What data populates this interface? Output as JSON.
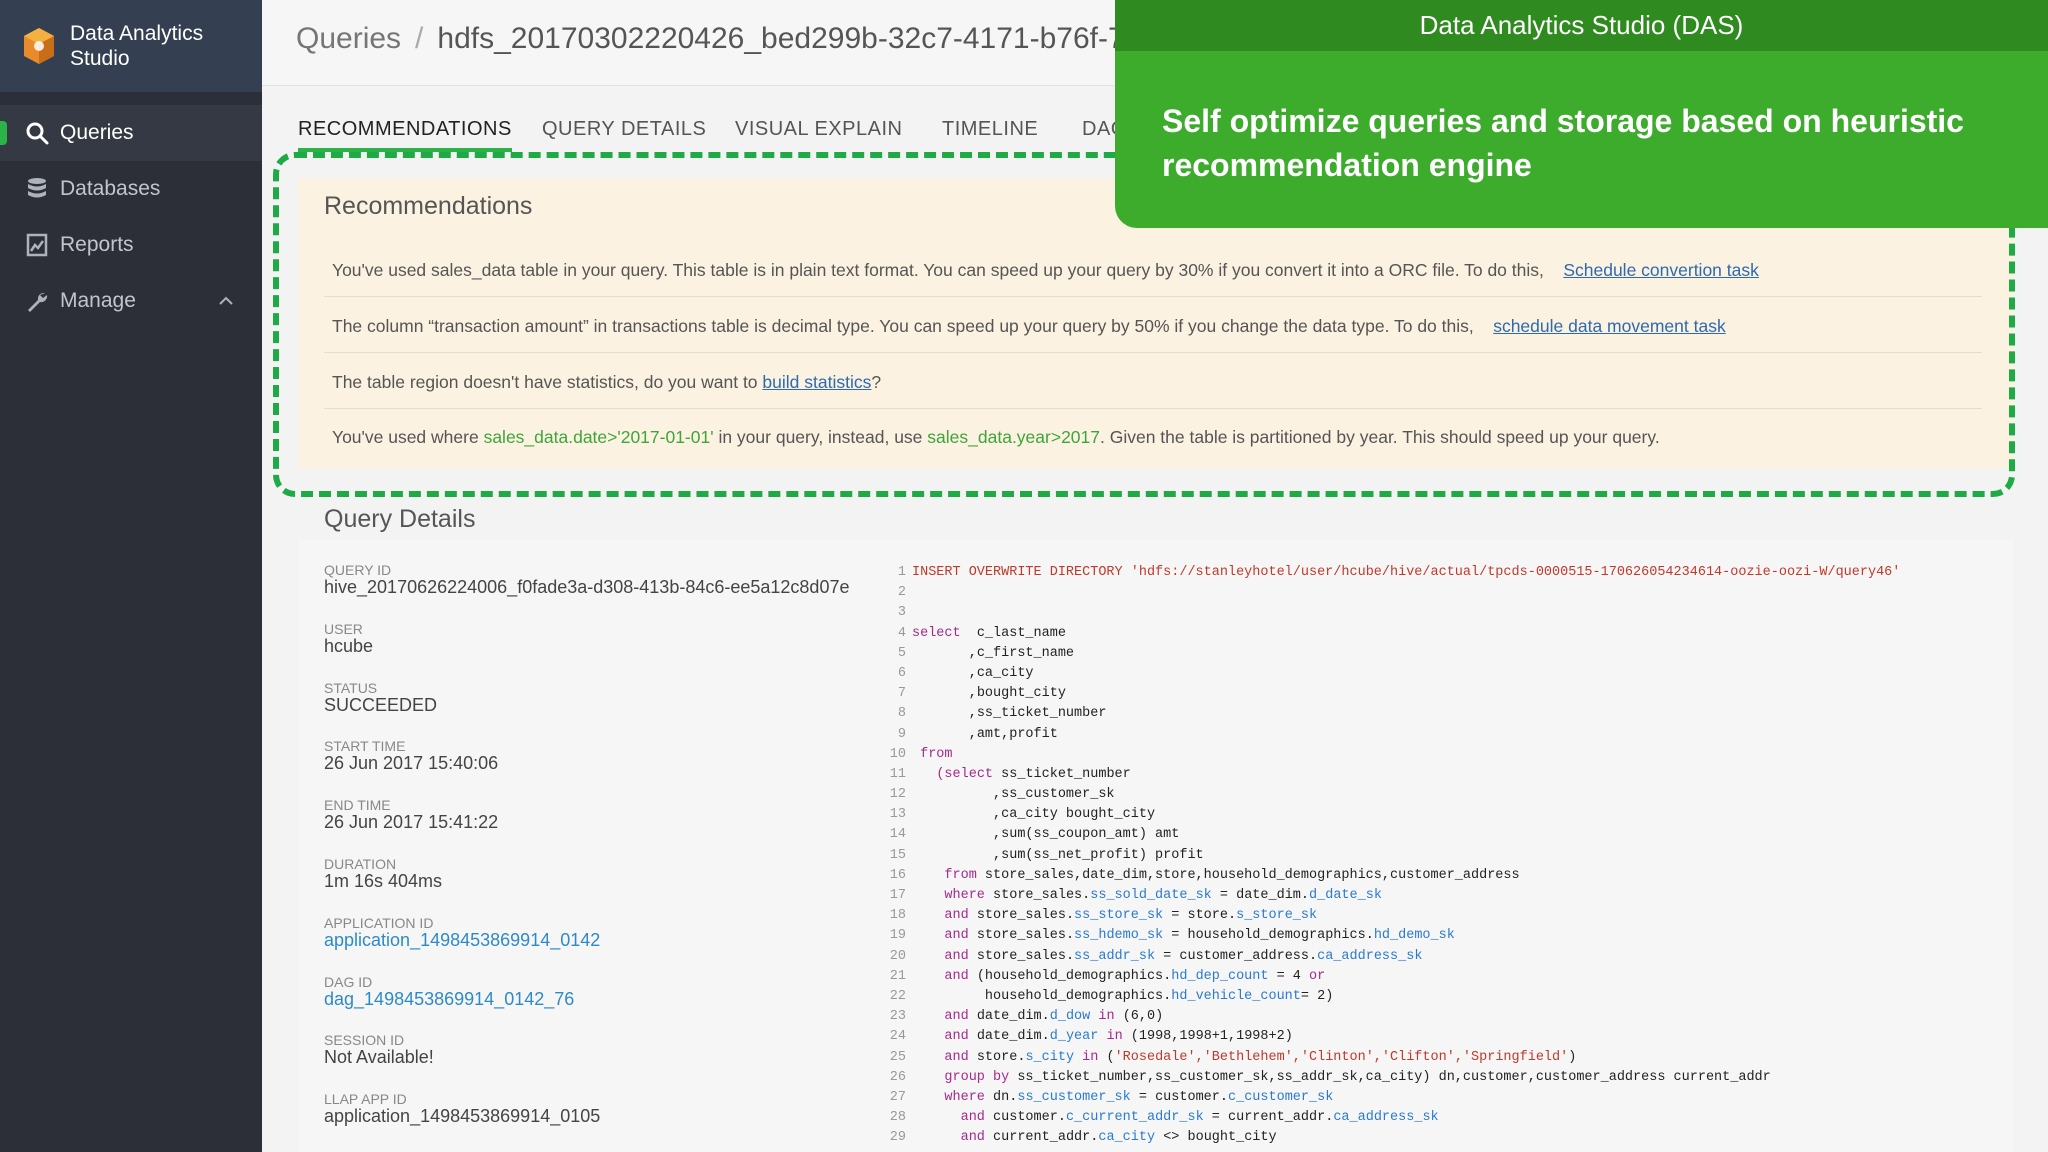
{
  "app": {
    "name": "Data Analytics Studio"
  },
  "sidebar": {
    "items": [
      {
        "label": "Queries",
        "icon": "search-icon",
        "active": true
      },
      {
        "label": "Databases",
        "icon": "database-icon"
      },
      {
        "label": "Reports",
        "icon": "reports-icon"
      },
      {
        "label": "Manage",
        "icon": "wrench-icon"
      }
    ]
  },
  "header": {
    "breadcrumb_root": "Queries",
    "breadcrumb_sep": "/",
    "breadcrumb_current": "hdfs_20170302220426_bed299b-32c7-4171-b76f-7"
  },
  "tabs": [
    "RECOMMENDATIONS",
    "QUERY DETAILS",
    "VISUAL EXPLAIN",
    "TIMELINE",
    "DAG"
  ],
  "overlay": {
    "title": "Data Analytics Studio (DAS)",
    "text": "Self optimize queries and storage based on heuristic recommendation engine"
  },
  "recommendations": {
    "title": "Recommendations",
    "row1_text": "You've used sales_data table in your query. This table is in plain text format. You can speed up your query by 30% if you convert it into a ORC file. To do this,",
    "row1_link": "Schedule convertion task",
    "row2_text": "The column “transaction amount” in transactions table is decimal type. You can speed up your query by 50% if you change the data type. To do this,",
    "row2_link": "schedule data movement task",
    "row3_text": "The table region doesn't have statistics, do you want to",
    "row3_link": "build statistics",
    "row3_end": "?",
    "row4_a": "You've used where",
    "row4_code1": "sales_data.date>'2017-01-01'",
    "row4_b": "in your query, instead, use",
    "row4_code2": "sales_data.year>2017",
    "row4_c": ". Given the table is partitioned by year. This should speed up your query."
  },
  "query_details": {
    "title": "Query Details",
    "fields": [
      {
        "label": "QUERY ID",
        "value": "hive_20170626224006_f0fade3a-d308-413b-84c6-ee5a12c8d07e"
      },
      {
        "label": "USER",
        "value": "hcube"
      },
      {
        "label": "STATUS",
        "value": "SUCCEEDED"
      },
      {
        "label": "START TIME",
        "value": "26 Jun 2017 15:40:06"
      },
      {
        "label": "END TIME",
        "value": "26 Jun 2017 15:41:22"
      },
      {
        "label": "DURATION",
        "value": "1m 16s 404ms"
      },
      {
        "label": "APPLICATION ID",
        "value": "application_1498453869914_0142"
      },
      {
        "label": "DAG ID",
        "value": "dag_1498453869914_0142_76"
      },
      {
        "label": "SESSION ID",
        "value": "Not Available!"
      },
      {
        "label": "LLAP APP ID",
        "value": "application_1498453869914_0105"
      }
    ]
  },
  "code": {
    "line_numbers": [
      "1",
      "2",
      "3",
      "4",
      "5",
      "6",
      "7",
      "8",
      "9",
      "10",
      "11",
      "12",
      "13",
      "14",
      "15",
      "16",
      "17",
      "18",
      "19",
      "20",
      "21",
      "22",
      "23",
      "24",
      "25",
      "26",
      "27",
      "28",
      "29"
    ],
    "insert_kw": "INSERT OVERWRITE DIRECTORY",
    "insert_path": "'hdfs://stanleyhotel/user/hcube/hive/actual/tpcds-0000515-170626054234614-oozie-oozi-W/query46'",
    "select": "select",
    "c_last_name": "c_last_name",
    "c_first_name": ",c_first_name",
    "ca_city": ",ca_city",
    "bought_city": ",bought_city",
    "ss_ticket_number": ",ss_ticket_number",
    "amt_profit": ",amt,profit",
    "from": "from",
    "l11_a": "(select",
    "l11_b": "ss_ticket_number",
    "l12": ",ss_customer_sk",
    "l13": ",ca_city bought_city",
    "l14": ",sum(ss_coupon_amt) amt",
    "l15": ",sum(ss_net_profit) profit",
    "l16_kw": "from",
    "l16": "store_sales,date_dim,store,household_demographics,customer_address",
    "where": "where",
    "and": "and",
    "group_by": "group by",
    "in": "in",
    "or": "or",
    "ss": "store_sales.",
    "dd": "date_dim.",
    "st": "store.",
    "hd": "household_demographics.",
    "ca": "customer_address.",
    "ss_sold_date_sk": "ss_sold_date_sk",
    "d_date_sk": "d_date_sk",
    "ss_store_sk": "ss_store_sk",
    "s_store_sk": "s_store_sk",
    "ss_hdemo_sk": "ss_hdemo_sk",
    "hd_demo_sk": "hd_demo_sk",
    "ss_addr_sk": "ss_addr_sk",
    "ca_address_sk": "ca_address_sk",
    "hd_dep_count": "hd_dep_count",
    "eq4": "= 4",
    "hd_vehicle_count": "hd_vehicle_count",
    "eq2": "= 2)",
    "d_dow": "d_dow",
    "dow_vals": "(6,0)",
    "d_year": "d_year",
    "year_vals": "(1998,1998+1,1998+2)",
    "s_city": "s_city",
    "city_vals": "'Rosedale','Bethlehem','Clinton','Clifton','Springfield'",
    "group_cols": "ss_ticket_number,ss_customer_sk,ss_addr_sk,ca_city) dn,customer,customer_address current_addr",
    "dn": "dn.",
    "ss_customer_sk": "ss_customer_sk",
    "customer": "customer.",
    "c_customer_sk": "c_customer_sk",
    "c_current_addr_sk": "c_current_addr_sk",
    "current_addr": "current_addr.",
    "ca_address_sk2": "ca_address_sk",
    "ca_city2": "ca_city",
    "neq_bought": "<> bought_city"
  },
  "colors": {
    "accent_green": "#2bb34a",
    "overlay_green": "#3dab2b",
    "sidebar_bg": "#2c2f38",
    "link_blue": "#2d6ab0"
  }
}
